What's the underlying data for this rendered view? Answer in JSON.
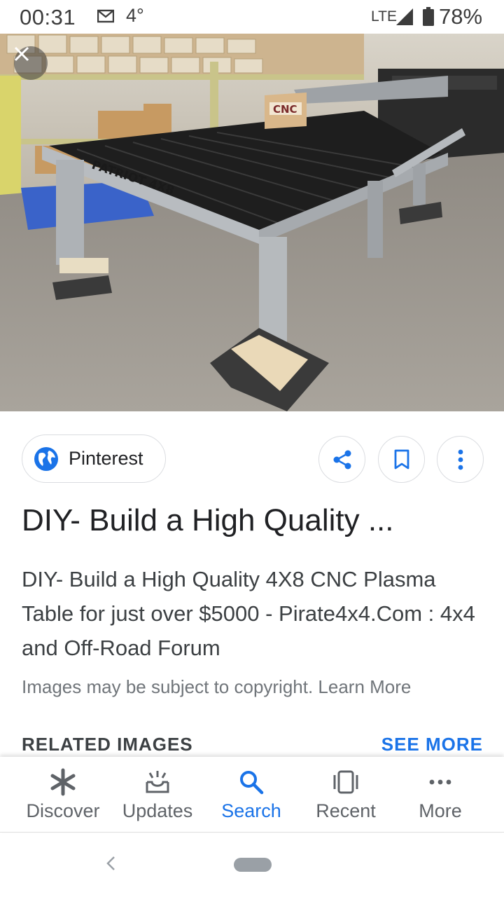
{
  "status_bar": {
    "time": "00:31",
    "temperature": "4°",
    "network": "LTE",
    "battery": "78%",
    "icons": [
      "mail-icon",
      "signal-icon",
      "battery-icon"
    ]
  },
  "viewer": {
    "close_icon": "close-icon",
    "image_text": {
      "table_brand": "PATRIOT 4X8",
      "box_label": "CNC"
    }
  },
  "source": {
    "label": "Pinterest",
    "icon": "globe-icon"
  },
  "actions": {
    "share_icon": "share-icon",
    "bookmark_icon": "bookmark-icon",
    "more_icon": "more-vertical-icon"
  },
  "result": {
    "title": "DIY- Build a High Quality ...",
    "description": "DIY- Build a High Quality 4X8 CNC Plasma Table for just over $5000 - Pirate4x4.Com : 4x4 and Off-Road Forum",
    "copyright": "Images may be subject to copyright. Learn More"
  },
  "related": {
    "label": "RELATED IMAGES",
    "see_more": "SEE MORE"
  },
  "bottom_nav": {
    "items": [
      {
        "label": "Discover",
        "icon": "asterisk-icon"
      },
      {
        "label": "Updates",
        "icon": "updates-icon"
      },
      {
        "label": "Search",
        "icon": "search-icon",
        "active": true
      },
      {
        "label": "Recent",
        "icon": "recent-icon"
      },
      {
        "label": "More",
        "icon": "more-horizontal-icon"
      }
    ]
  },
  "colors": {
    "accent": "#1a73e8",
    "text_primary": "#202124",
    "text_secondary": "#70757a"
  }
}
